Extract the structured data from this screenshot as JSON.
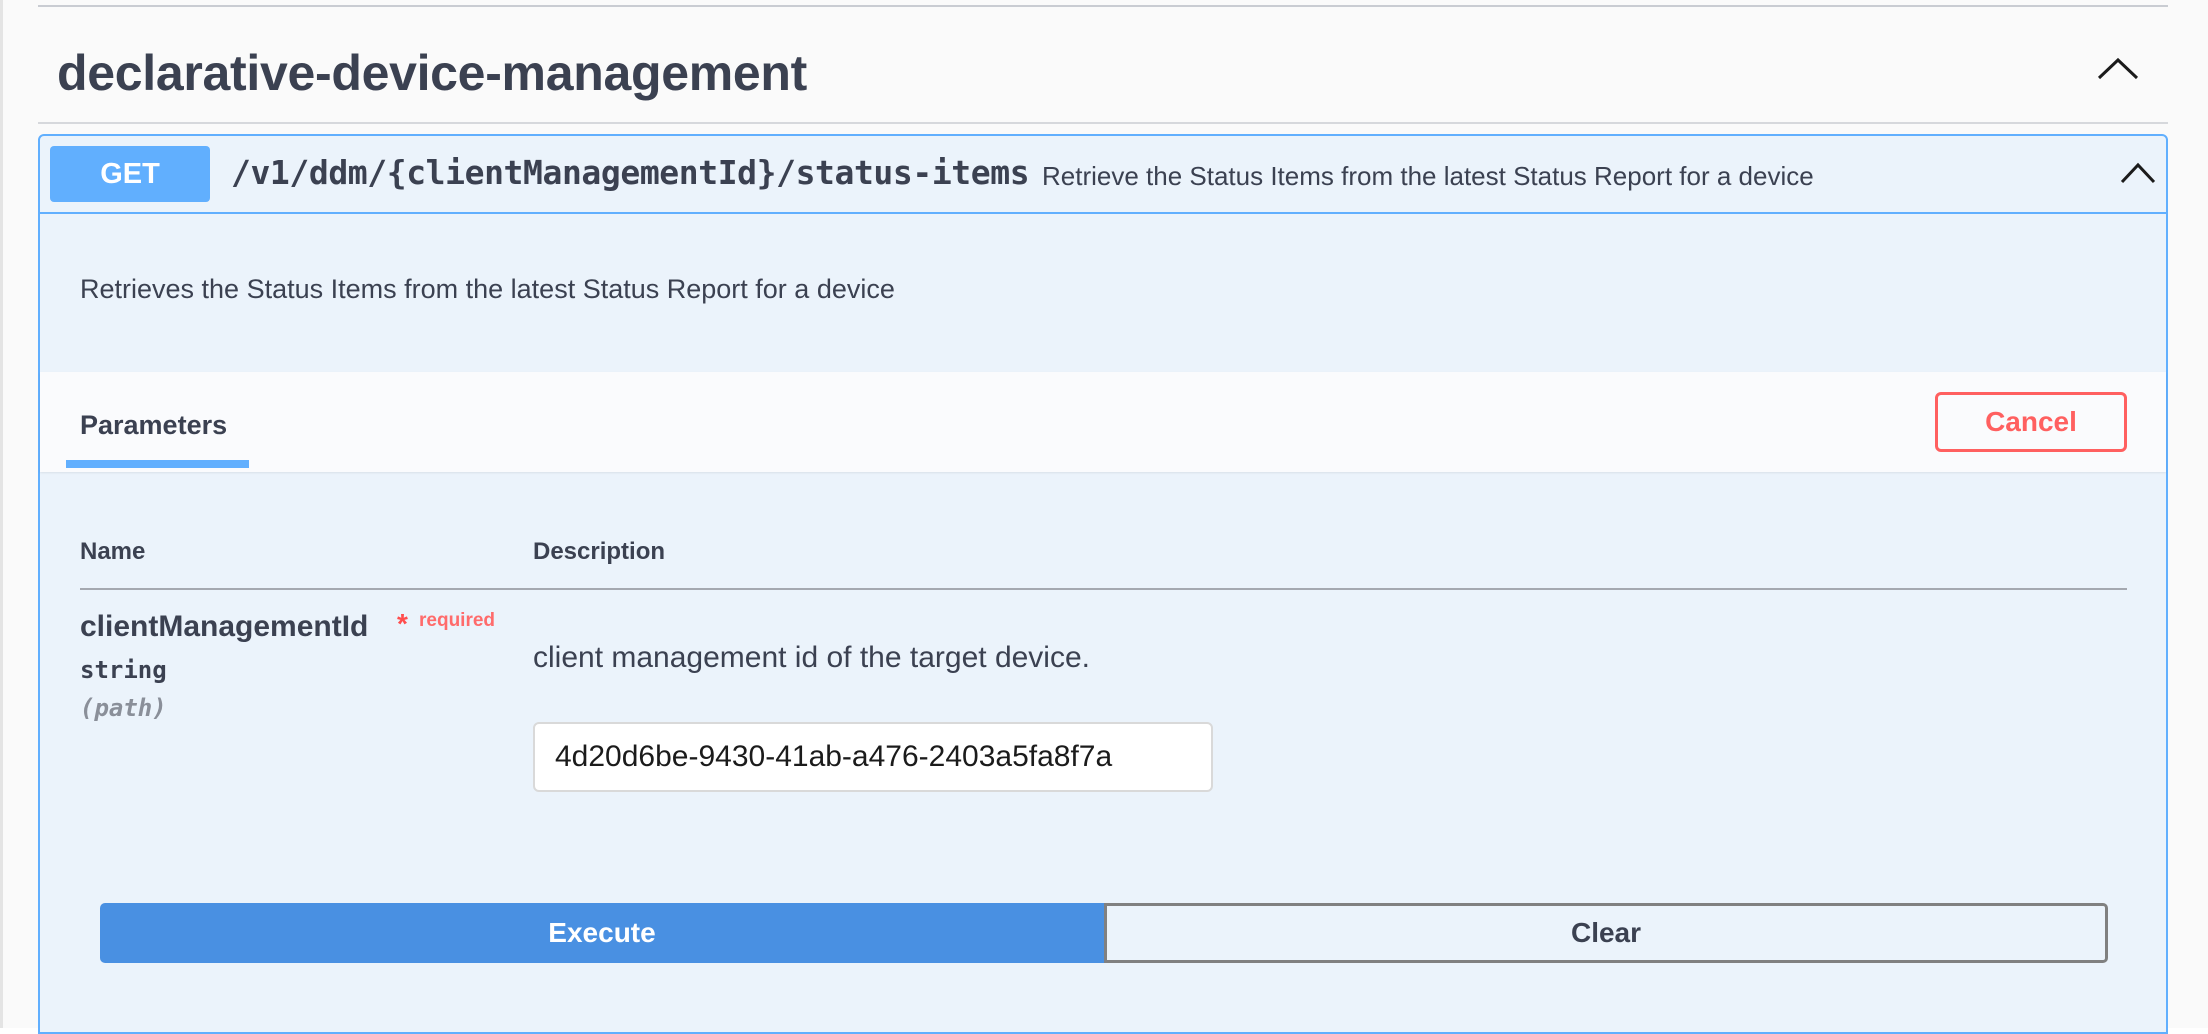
{
  "tag": {
    "title": "declarative-device-management",
    "chevron_icon": "chevron-up-icon"
  },
  "operation": {
    "method": "GET",
    "path": "/v1/ddm/{clientManagementId}/status-items",
    "summary": "Retrieve the Status Items from the latest Status Report for a device",
    "description": "Retrieves the Status Items from the latest Status Report for a device",
    "chevron_icon": "chevron-up-icon",
    "method_color": "#61affe"
  },
  "parameters_section": {
    "tab_label": "Parameters",
    "cancel_label": "Cancel",
    "columns": {
      "name": "Name",
      "description": "Description"
    },
    "params": [
      {
        "name": "clientManagementId",
        "required_marker": "*",
        "required_label": "required",
        "type": "string",
        "in": "(path)",
        "description": "client management id of the target device.",
        "value": "4d20d6be-9430-41ab-a476-2403a5fa8f7a"
      }
    ]
  },
  "actions": {
    "execute_label": "Execute",
    "clear_label": "Clear",
    "execute_color": "#4990e2",
    "cancel_color": "#ff6060"
  }
}
